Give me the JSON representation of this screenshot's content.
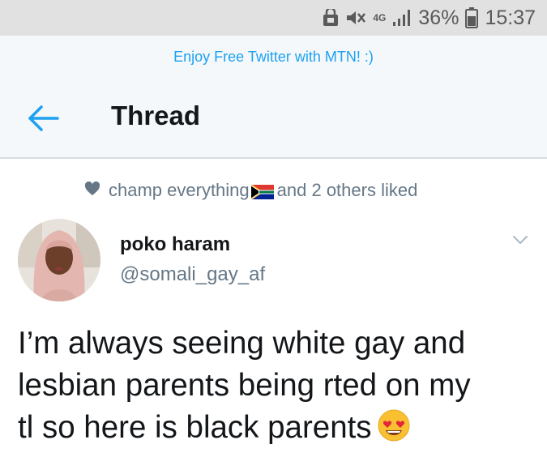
{
  "status_bar": {
    "network": "4G",
    "battery": "36%",
    "time": "15:37",
    "icons": [
      "alarm-lock-icon",
      "mute-icon",
      "network-4g-icon",
      "signal-icon",
      "battery-icon"
    ]
  },
  "promo": {
    "text": "Enjoy Free Twitter with MTN! :)"
  },
  "header": {
    "back_icon": "arrow-left-icon",
    "title": "Thread"
  },
  "social_context": {
    "icon": "heart-icon",
    "text_before": "champ everything",
    "flag": "south-africa-flag-emoji",
    "text_after": "and 2 others liked"
  },
  "tweet": {
    "author_name": "poko haram",
    "author_handle": "@somali_gay_af",
    "caret_icon": "chevron-down-icon",
    "text_lines": [
      "I’m always seeing white gay and",
      "lesbian parents being rted on my",
      "tl so here is black parents"
    ],
    "emoji": "heart-eyes-emoji"
  },
  "colors": {
    "accent": "#1da1f2",
    "secondary_text": "#657786",
    "primary_text": "#14171a",
    "header_bg": "#f5f8fa",
    "status_bar_bg": "#e1e1e1"
  }
}
